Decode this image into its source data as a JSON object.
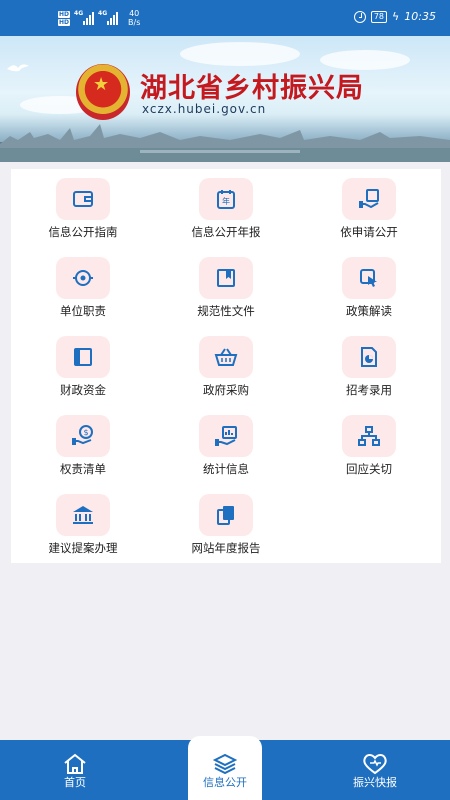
{
  "status_bar": {
    "network": "4G",
    "network2": "4G",
    "speed_value": "40",
    "speed_unit": "B/s",
    "battery": "78",
    "time": "10:35"
  },
  "banner": {
    "title": "湖北省乡村振兴局",
    "url": "xczx.hubei.gov.cn"
  },
  "menu": {
    "items": [
      {
        "label": "信息公开指南",
        "icon": "wallet-icon"
      },
      {
        "label": "信息公开年报",
        "icon": "annual-report-icon"
      },
      {
        "label": "依申请公开",
        "icon": "hand-document-icon"
      },
      {
        "label": "单位职责",
        "icon": "target-eye-icon"
      },
      {
        "label": "规范性文件",
        "icon": "bookmark-doc-icon"
      },
      {
        "label": "政策解读",
        "icon": "touch-doc-icon"
      },
      {
        "label": "财政资金",
        "icon": "panel-icon"
      },
      {
        "label": "政府采购",
        "icon": "basket-icon"
      },
      {
        "label": "招考录用",
        "icon": "chart-doc-icon"
      },
      {
        "label": "权责清单",
        "icon": "money-hand-icon"
      },
      {
        "label": "统计信息",
        "icon": "stats-hand-icon"
      },
      {
        "label": "回应关切",
        "icon": "org-chart-icon"
      },
      {
        "label": "建议提案办理",
        "icon": "institution-icon"
      },
      {
        "label": "网站年度报告",
        "icon": "copy-docs-icon"
      }
    ]
  },
  "tabbar": {
    "tabs": [
      {
        "label": "首页",
        "icon": "home-icon"
      },
      {
        "label": "信息公开",
        "icon": "layers-icon"
      },
      {
        "label": "振兴快报",
        "icon": "heart-icon"
      }
    ],
    "active_index": 1
  },
  "colors": {
    "primary": "#1f6fc0",
    "icon_bg": "#fde9e9",
    "title_red": "#c3191f"
  }
}
